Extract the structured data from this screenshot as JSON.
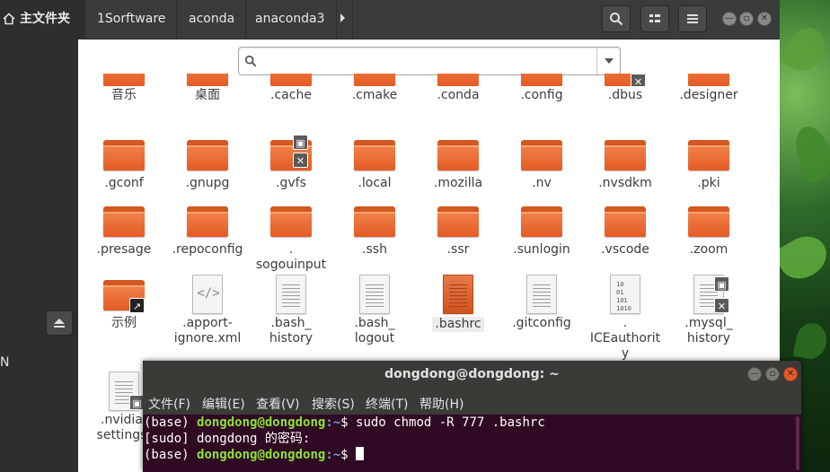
{
  "header": {
    "home": "主文件夹",
    "breadcrumbs": [
      "1Sorftware",
      "aconda",
      "anaconda3"
    ]
  },
  "search": {
    "value": "",
    "placeholder": ""
  },
  "sidebar": {
    "partial_label": "N"
  },
  "files": {
    "row0": [
      "音乐",
      "桌面",
      ".cache",
      ".cmake",
      ".conda",
      ".config",
      ".dbus",
      ".designer"
    ],
    "row1": [
      ".gconf",
      ".gnupg",
      ".gvfs",
      ".local",
      ".mozilla",
      ".nv",
      ".nvsdkm",
      ".pki"
    ],
    "row2": [
      ".presage",
      ".repoconfig",
      ".\nsogouinput",
      ".ssh",
      ".ssr",
      ".sunlogin",
      ".vscode",
      ".zoom"
    ],
    "row3": [
      "示例",
      ".apport-\nignore.xml",
      ".bash_\nhistory",
      ".bash_\nlogout",
      ".bashrc",
      ".gitconfig",
      ".\nICEauthorit\ny",
      ".mysql_\nhistory"
    ],
    "row4": [
      ".nvidia-\nsettings-"
    ]
  },
  "terminal": {
    "title": "dongdong@dongdong: ~",
    "menu": [
      "文件(F)",
      "编辑(E)",
      "查看(V)",
      "搜索(S)",
      "终端(T)",
      "帮助(H)"
    ],
    "lines": [
      {
        "env": "(base) ",
        "user": "dongdong@dongdong",
        "path": ":~",
        "prompt": "$ ",
        "cmd": "sudo chmod -R 777 .bashrc"
      },
      {
        "text": "[sudo] dongdong 的密码:"
      },
      {
        "env": "(base) ",
        "user": "dongdong@dongdong",
        "path": ":~",
        "prompt": "$ ",
        "cmd": ""
      }
    ]
  },
  "colors": {
    "folder": "#e45a24",
    "terminal_bg": "#300a24",
    "user": "#8ae234",
    "path": "#729fcf",
    "close": "#e25a2b"
  },
  "icons": {
    "home": "home-icon",
    "search": "search-icon",
    "view": "view-grid-icon",
    "menu": "hamburger-menu-icon",
    "eject": "eject-icon",
    "lock": "lock-icon",
    "no_access": "x-icon",
    "link": "link-arrow-icon"
  }
}
